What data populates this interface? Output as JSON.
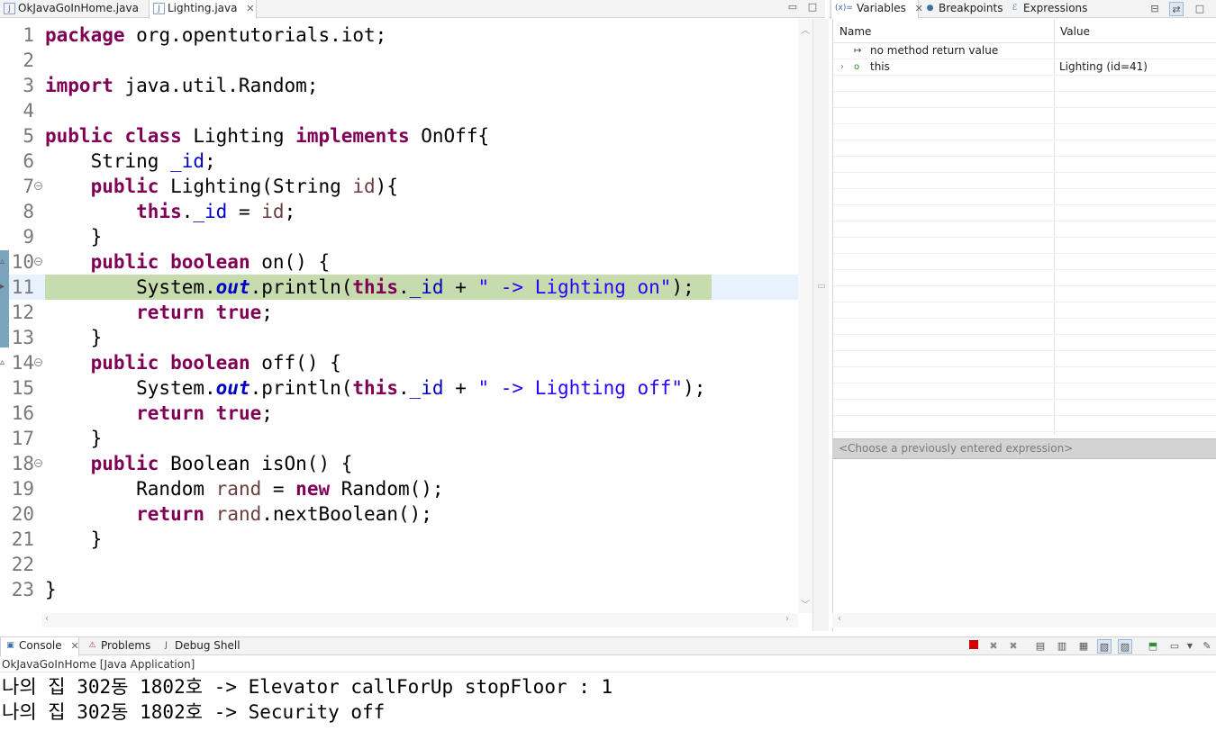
{
  "editor": {
    "tabs": [
      {
        "label": "OkJavaGoInHome.java",
        "active": false
      },
      {
        "label": "Lighting.java",
        "active": true
      }
    ],
    "lines": [
      {
        "n": "1",
        "html": "<span class=\"kw\">package</span> org.opentutorials.iot;"
      },
      {
        "n": "2",
        "html": ""
      },
      {
        "n": "3",
        "html": "<span class=\"kw\">import</span> java.util.Random;"
      },
      {
        "n": "4",
        "html": ""
      },
      {
        "n": "5",
        "html": "<span class=\"kw\">public</span> <span class=\"kw\">class</span> Lighting <span class=\"kw\">implements</span> OnOff{"
      },
      {
        "n": "6",
        "html": "    String <span class=\"fld\">_id</span>;"
      },
      {
        "n": "7",
        "html": "    <span class=\"kw\">public</span> Lighting(String <span class=\"var\">id</span>){",
        "fold": true
      },
      {
        "n": "8",
        "html": "        <span class=\"kw\">this</span>.<span class=\"fld\">_id</span> = <span class=\"var\">id</span>;"
      },
      {
        "n": "9",
        "html": "    }"
      },
      {
        "n": "10",
        "html": "    <span class=\"kw\">public</span> <span class=\"kw\">boolean</span> on() {",
        "fold": true
      },
      {
        "n": "11",
        "html": "        System.<span class=\"sfld\">out</span>.println(<span class=\"kw\">this</span>.<span class=\"fld\">_id</span> + <span class=\"str\">\" -> Lighting on\"</span>);",
        "exec": true
      },
      {
        "n": "12",
        "html": "        <span class=\"kw\">return</span> <span class=\"kw\">true</span>;"
      },
      {
        "n": "13",
        "html": "    }"
      },
      {
        "n": "14",
        "html": "    <span class=\"kw\">public</span> <span class=\"kw\">boolean</span> off() {",
        "fold": true
      },
      {
        "n": "15",
        "html": "        System.<span class=\"sfld\">out</span>.println(<span class=\"kw\">this</span>.<span class=\"fld\">_id</span> + <span class=\"str\">\" -> Lighting off\"</span>);"
      },
      {
        "n": "16",
        "html": "        <span class=\"kw\">return</span> <span class=\"kw\">true</span>;"
      },
      {
        "n": "17",
        "html": "    }"
      },
      {
        "n": "18",
        "html": "    <span class=\"kw\">public</span> Boolean isOn() {",
        "fold": true
      },
      {
        "n": "19",
        "html": "        Random <span class=\"var\">rand</span> = <span class=\"kw\">new</span> Random();"
      },
      {
        "n": "20",
        "html": "        <span class=\"kw\">return</span> <span class=\"var\">rand</span>.nextBoolean();"
      },
      {
        "n": "21",
        "html": "    }"
      },
      {
        "n": "22",
        "html": ""
      },
      {
        "n": "23",
        "html": "}"
      }
    ]
  },
  "debug_views": {
    "tabs": [
      {
        "label": "Variables",
        "active": true,
        "icon": "variables-icon"
      },
      {
        "label": "Breakpoints",
        "active": false,
        "icon": "breakpoints-icon"
      },
      {
        "label": "Expressions",
        "active": false,
        "icon": "expressions-icon"
      }
    ],
    "columns": {
      "name": "Name",
      "value": "Value"
    },
    "rows": [
      {
        "name": "no method return value",
        "value": "",
        "icon": "return-value-icon",
        "expandable": false
      },
      {
        "name": "this",
        "value": "Lighting  (id=41)",
        "icon": "object-icon",
        "expandable": true
      }
    ],
    "expression_placeholder": "<Choose a previously entered expression>"
  },
  "console": {
    "tabs": [
      {
        "label": "Console",
        "active": true,
        "icon": "console-icon"
      },
      {
        "label": "Problems",
        "active": false,
        "icon": "problems-icon"
      },
      {
        "label": "Debug Shell",
        "active": false,
        "icon": "debug-shell-icon"
      }
    ],
    "launch_label": "OkJavaGoInHome [Java Application]",
    "output": [
      "나의 집 302동 1802호 -> Elevator callForUp stopFloor : 1",
      "나의 집 302동 1802호 -> Security off"
    ]
  },
  "colors": {
    "keyword": "#7f0055",
    "field": "#0000c0",
    "string": "#2a00ff",
    "exec_highlight": "#c6dbae",
    "current_line": "#e8f2fe"
  }
}
